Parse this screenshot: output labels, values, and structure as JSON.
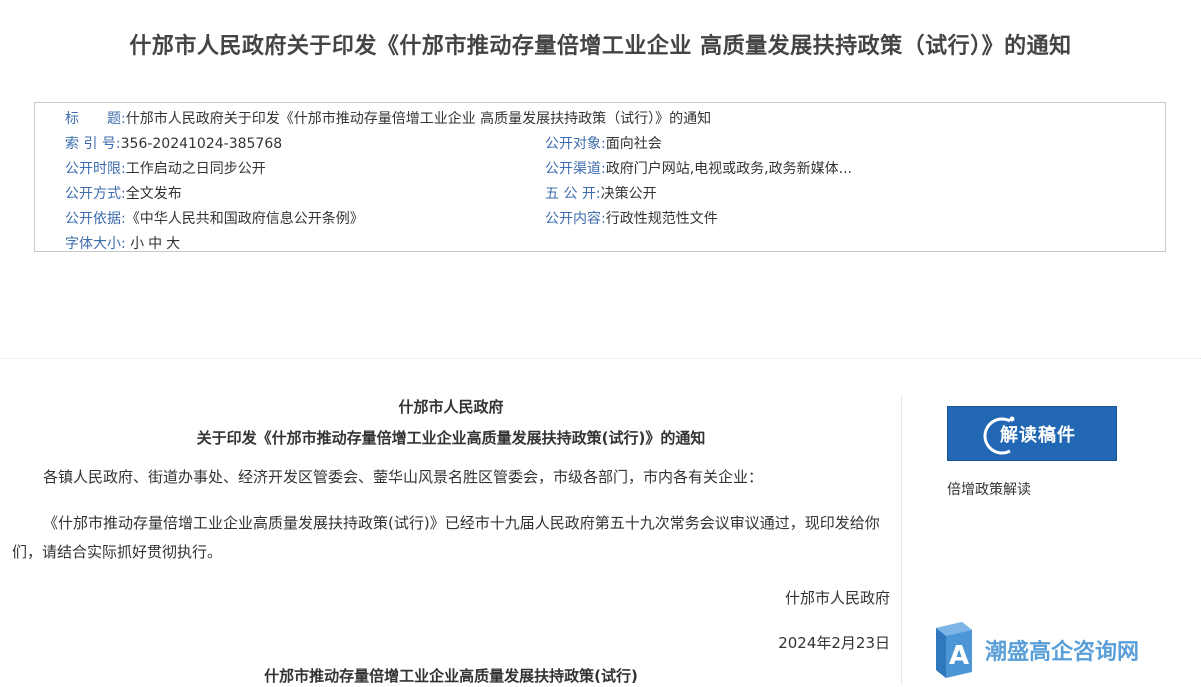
{
  "page": {
    "title": "什邡市人民政府关于印发《什邡市推动存量倍增工业企业 高质量发展扶持政策（试行）》的通知"
  },
  "meta": {
    "title": {
      "label": "标　　题:",
      "value": "什邡市人民政府关于印发《什邡市推动存量倍增工业企业 高质量发展扶持政策（试行）》的通知"
    },
    "index_no": {
      "label": "索 引 号:",
      "value": "356-20241024-385768"
    },
    "audience": {
      "label": "公开对象:",
      "value": "面向社会"
    },
    "time_limit": {
      "label": "公开时限:",
      "value": "工作启动之日同步公开"
    },
    "channel": {
      "label": "公开渠道:",
      "value": "政府门户网站,电视或政务,政务新媒体..."
    },
    "method": {
      "label": "公开方式:",
      "value": "全文发布"
    },
    "five_public": {
      "label": "五 公 开:",
      "value": "决策公开"
    },
    "basis": {
      "label": "公开依据:",
      "value": "《中华人民共和国政府信息公开条例》"
    },
    "content": {
      "label": "公开内容:",
      "value": "行政性规范性文件"
    },
    "font_size": {
      "label": "字体大小:",
      "small": "小",
      "medium": "中",
      "large": "大"
    }
  },
  "doc": {
    "issuer": "什邡市人民政府",
    "title": "关于印发《什邡市推动存量倍增工业企业高质量发展扶持政策(试行)》的通知",
    "recipients": "各镇人民政府、街道办事处、经济开发区管委会、蓥华山风景名胜区管委会，市级各部门，市内各有关企业：",
    "body": "《什邡市推动存量倍增工业企业高质量发展扶持政策(试行)》已经市十九届人民政府第五十九次常务会议审议通过，现印发给你们，请结合实际抓好贯彻执行。",
    "signature": "什邡市人民政府",
    "date": "2024年2月23日",
    "subtitle": "什邡市推动存量倍增工业企业高质量发展扶持政策(试行)"
  },
  "sidebar": {
    "button_label": "解读稿件",
    "link_label": "倍增政策解读"
  },
  "watermark": {
    "text": "潮盛高企咨询网",
    "icon": "a-letter-logo-icon"
  },
  "colors": {
    "label_blue": "#3d6dae",
    "button_blue": "#2167b3",
    "watermark_blue": "#5a9fd8"
  }
}
